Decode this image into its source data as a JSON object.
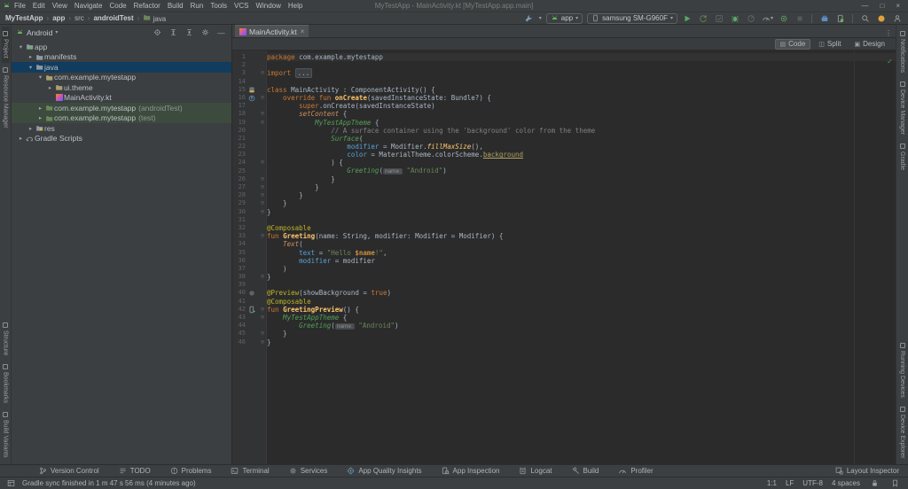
{
  "window": {
    "title": "MyTestApp - MainActivity.kt [MyTestApp.app.main]",
    "controls": {
      "minimize": "—",
      "maximize": "□",
      "close": "×"
    }
  },
  "menu_bar": {
    "items": [
      "File",
      "Edit",
      "View",
      "Navigate",
      "Code",
      "Refactor",
      "Build",
      "Run",
      "Tools",
      "VCS",
      "Window",
      "Help"
    ]
  },
  "breadcrumbs": [
    {
      "label": "MyTestApp",
      "bold": true
    },
    {
      "label": "app",
      "bold": true
    },
    {
      "label": "src",
      "bold": false
    },
    {
      "label": "androidTest",
      "bold": true
    },
    {
      "label": "java",
      "bold": false,
      "folder_icon": true
    }
  ],
  "run_toolbar": {
    "config": "app",
    "device": "samsung SM-G960F"
  },
  "left_stripe": {
    "top": [
      "Project",
      "Resource Manager"
    ],
    "bottom": [
      "Structure",
      "Bookmarks",
      "Build Variants"
    ],
    "active": "Project"
  },
  "right_stripe": {
    "top": [
      "Notifications",
      "Device Manager",
      "Gradle"
    ],
    "bottom": [
      "Running Devices",
      "Device Explorer"
    ]
  },
  "project_panel": {
    "mode": "Android",
    "tree": [
      {
        "label": "app",
        "level": 0,
        "arrow": "down",
        "icon": "module"
      },
      {
        "label": "manifests",
        "level": 1,
        "arrow": "right",
        "icon": "folder"
      },
      {
        "label": "java",
        "level": 1,
        "arrow": "down",
        "icon": "folder",
        "selected": true
      },
      {
        "label": "com.example.mytestapp",
        "level": 2,
        "arrow": "down",
        "icon": "pkg"
      },
      {
        "label": "ui.theme",
        "level": 3,
        "arrow": "right",
        "icon": "pkg"
      },
      {
        "label": "MainActivity.kt",
        "level": 3,
        "arrow": "none",
        "icon": "kotlin"
      },
      {
        "label": "com.example.mytestapp",
        "suffix": "(androidTest)",
        "level": 2,
        "arrow": "right",
        "icon": "pkg",
        "test": true
      },
      {
        "label": "com.example.mytestapp",
        "suffix": "(test)",
        "level": 2,
        "arrow": "right",
        "icon": "pkg",
        "test": true
      },
      {
        "label": "res",
        "level": 1,
        "arrow": "right",
        "icon": "res"
      },
      {
        "label": "Gradle Scripts",
        "level": 0,
        "arrow": "right",
        "icon": "elephant"
      }
    ]
  },
  "editor": {
    "tab": "MainActivity.kt",
    "views": [
      "Code",
      "Split",
      "Design"
    ],
    "active_view": "Code",
    "lines": [
      {
        "n": 1,
        "c": 1,
        "s": [
          [
            "kw",
            "package"
          ],
          [
            "d",
            " com.example.mytestapp"
          ]
        ]
      },
      {
        "n": 2,
        "s": []
      },
      {
        "n": 3,
        "f": 1,
        "s": [
          [
            "kw",
            "import"
          ],
          [
            "d",
            " "
          ],
          [
            "chip",
            "..."
          ]
        ]
      },
      {
        "n": 14,
        "s": []
      },
      {
        "n": 15,
        "g": "classm",
        "s": [
          [
            "kw",
            "class"
          ],
          [
            "d",
            " MainActivity : ComponentActivity() {"
          ]
        ]
      },
      {
        "n": 16,
        "g": "override",
        "f": 1,
        "s": [
          [
            "kw",
            "    override fun "
          ],
          [
            "fn",
            "onCreate"
          ],
          [
            "d",
            "(savedInstanceState: Bundle?) {"
          ]
        ]
      },
      {
        "n": 17,
        "s": [
          [
            "kw",
            "        super"
          ],
          [
            "d",
            ".onCreate(savedInstanceState)"
          ]
        ]
      },
      {
        "n": 18,
        "f": 1,
        "s": [
          [
            "co",
            "        setContent"
          ],
          [
            "d",
            " {"
          ]
        ]
      },
      {
        "n": 19,
        "f": 1,
        "s": [
          [
            "cg",
            "            MyTestAppTheme"
          ],
          [
            "d",
            " {"
          ]
        ]
      },
      {
        "n": 20,
        "s": [
          [
            "cmt",
            "                // A surface container using the 'background' color from the theme"
          ]
        ]
      },
      {
        "n": 21,
        "s": [
          [
            "cg",
            "                Surface"
          ],
          [
            "d",
            "("
          ]
        ]
      },
      {
        "n": 22,
        "s": [
          [
            "nm",
            "                    modifier"
          ],
          [
            "d",
            " = Modifier."
          ],
          [
            "ext",
            "fillMaxSize"
          ],
          [
            "d",
            "(),"
          ]
        ]
      },
      {
        "n": 23,
        "s": [
          [
            "nm",
            "                    color"
          ],
          [
            "d",
            " = MaterialTheme.colorScheme."
          ],
          [
            "prop",
            "background"
          ]
        ]
      },
      {
        "n": 24,
        "f": 1,
        "s": [
          [
            "d",
            "                ) {"
          ]
        ]
      },
      {
        "n": 25,
        "s": [
          [
            "cg",
            "                    Greeting"
          ],
          [
            "d",
            "("
          ],
          [
            "hint",
            "name:"
          ],
          [
            "str",
            " \"Android\""
          ],
          [
            "d",
            ")"
          ]
        ]
      },
      {
        "n": 26,
        "f": 1,
        "s": [
          [
            "d",
            "                }"
          ]
        ]
      },
      {
        "n": 27,
        "f": 1,
        "s": [
          [
            "d",
            "            }"
          ]
        ]
      },
      {
        "n": 28,
        "f": 1,
        "s": [
          [
            "d",
            "        }"
          ]
        ]
      },
      {
        "n": 29,
        "f": 1,
        "s": [
          [
            "d",
            "    }"
          ]
        ]
      },
      {
        "n": 30,
        "f": 1,
        "s": [
          [
            "d",
            "}"
          ]
        ]
      },
      {
        "n": 31,
        "s": []
      },
      {
        "n": 32,
        "s": [
          [
            "ann",
            "@Composable"
          ]
        ]
      },
      {
        "n": 33,
        "f": 1,
        "s": [
          [
            "kw",
            "fun "
          ],
          [
            "fn",
            "Greeting"
          ],
          [
            "d",
            "(name: String, modifier: Modifier = Modifier) {"
          ]
        ]
      },
      {
        "n": 34,
        "s": [
          [
            "co",
            "    Text"
          ],
          [
            "d",
            "("
          ]
        ]
      },
      {
        "n": 35,
        "s": [
          [
            "nm",
            "        text"
          ],
          [
            "d",
            " = "
          ],
          [
            "str",
            "\"Hello "
          ],
          [
            "tpl",
            "$name"
          ],
          [
            "str",
            "!\""
          ],
          [
            "d",
            ","
          ]
        ]
      },
      {
        "n": 36,
        "s": [
          [
            "nm",
            "        modifier"
          ],
          [
            "d",
            " = modifier"
          ]
        ]
      },
      {
        "n": 37,
        "s": [
          [
            "d",
            "    )"
          ]
        ]
      },
      {
        "n": 38,
        "f": 1,
        "s": [
          [
            "d",
            "}"
          ]
        ]
      },
      {
        "n": 39,
        "s": []
      },
      {
        "n": 40,
        "g": "gear",
        "s": [
          [
            "ann",
            "@Preview"
          ],
          [
            "d",
            "(showBackground = "
          ],
          [
            "kw",
            "true"
          ],
          [
            "d",
            ")"
          ]
        ]
      },
      {
        "n": 41,
        "s": [
          [
            "ann",
            "@Composable"
          ]
        ]
      },
      {
        "n": 42,
        "g": "phoneRun",
        "f": 1,
        "s": [
          [
            "kw",
            "fun "
          ],
          [
            "fn",
            "GreetingPreview"
          ],
          [
            "d",
            "() {"
          ]
        ]
      },
      {
        "n": 43,
        "f": 1,
        "s": [
          [
            "cg",
            "    MyTestAppTheme"
          ],
          [
            "d",
            " {"
          ]
        ]
      },
      {
        "n": 44,
        "s": [
          [
            "cg",
            "        Greeting"
          ],
          [
            "d",
            "("
          ],
          [
            "hint",
            "name:"
          ],
          [
            "str",
            " \"Android\""
          ],
          [
            "d",
            ")"
          ]
        ]
      },
      {
        "n": 45,
        "f": 1,
        "s": [
          [
            "d",
            "    }"
          ]
        ]
      },
      {
        "n": 46,
        "f": 1,
        "s": [
          [
            "d",
            "}"
          ]
        ]
      }
    ]
  },
  "bottom_toolbar": {
    "left": [
      {
        "icon": "branch",
        "label": "Version Control"
      },
      {
        "icon": "todo",
        "label": "TODO"
      },
      {
        "icon": "problems",
        "label": "Problems"
      },
      {
        "icon": "terminal",
        "label": "Terminal"
      },
      {
        "icon": "services",
        "label": "Services"
      },
      {
        "icon": "aqi",
        "label": "App Quality Insights"
      },
      {
        "icon": "inspection",
        "label": "App Inspection"
      },
      {
        "icon": "logcat",
        "label": "Logcat"
      },
      {
        "icon": "hammer",
        "label": "Build"
      },
      {
        "icon": "gauge",
        "label": "Profiler"
      }
    ],
    "right": [
      {
        "icon": "layoutins",
        "label": "Layout Inspector"
      }
    ]
  },
  "status_bar": {
    "message": "Gradle sync finished in 1 m 47 s 56 ms (4 minutes ago)",
    "caret_position": "1:1",
    "line_separator": "LF",
    "encoding": "UTF-8",
    "indent": "4 spaces"
  },
  "colors": {
    "panel_bg": "#3c3f41",
    "editor_bg": "#2b2b2b",
    "selection_blue": "#113c5e",
    "test_source_green": "#3c4b3e",
    "run_green": "#59a869",
    "sync_badge_orange": "#e0a23a",
    "inspection_ok_green": "#499c54"
  }
}
